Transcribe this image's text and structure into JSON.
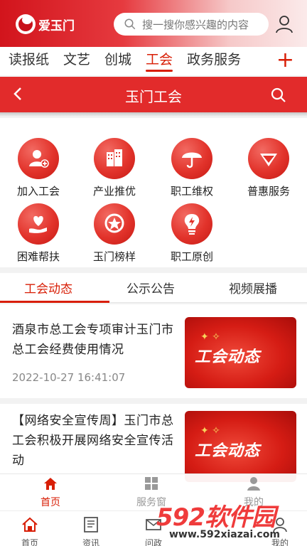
{
  "header": {
    "logo_text": "爱玉门",
    "search_placeholder": "搜一搜你感兴趣的内容"
  },
  "channels": {
    "tabs": [
      "读报纸",
      "文艺",
      "创城",
      "工会",
      "政务服务"
    ],
    "active": "工会",
    "plus": "+"
  },
  "title_bar": {
    "title": "玉门工会"
  },
  "grid": {
    "items": [
      {
        "label": "加入工会",
        "icon": "add-user-icon"
      },
      {
        "label": "产业推优",
        "icon": "building-icon"
      },
      {
        "label": "职工维权",
        "icon": "umbrella-icon"
      },
      {
        "label": "普惠服务",
        "icon": "diamond-icon"
      },
      {
        "label": "困难帮扶",
        "icon": "heart-hand-icon"
      },
      {
        "label": "玉门榜样",
        "icon": "star-badge-icon"
      },
      {
        "label": "职工原创",
        "icon": "bulb-icon"
      }
    ]
  },
  "sub_tabs": {
    "tabs": [
      "工会动态",
      "公示公告",
      "视频展播"
    ],
    "active": "工会动态"
  },
  "news": [
    {
      "title": "酒泉市总工会专项审计玉门市总工会经费使用情况",
      "time": "2022-10-27 16:41:07",
      "thumb_text": "工会动态"
    },
    {
      "title": "【网络安全宣传周】玉门市总工会积极开展网络安全宣传活动",
      "time": "",
      "thumb_text": "工会动态"
    }
  ],
  "bottom_nav": {
    "items": [
      "首页",
      "服务窗",
      "我的"
    ],
    "active": "首页"
  },
  "bottom_bar2": {
    "items": [
      "首页",
      "资讯",
      "问政",
      "",
      "我的"
    ]
  },
  "watermark": {
    "main": "592软件园",
    "sub": "www.592xiazai.com"
  },
  "colors": {
    "accent": "#d81e06",
    "bar": "#e22b2b"
  }
}
